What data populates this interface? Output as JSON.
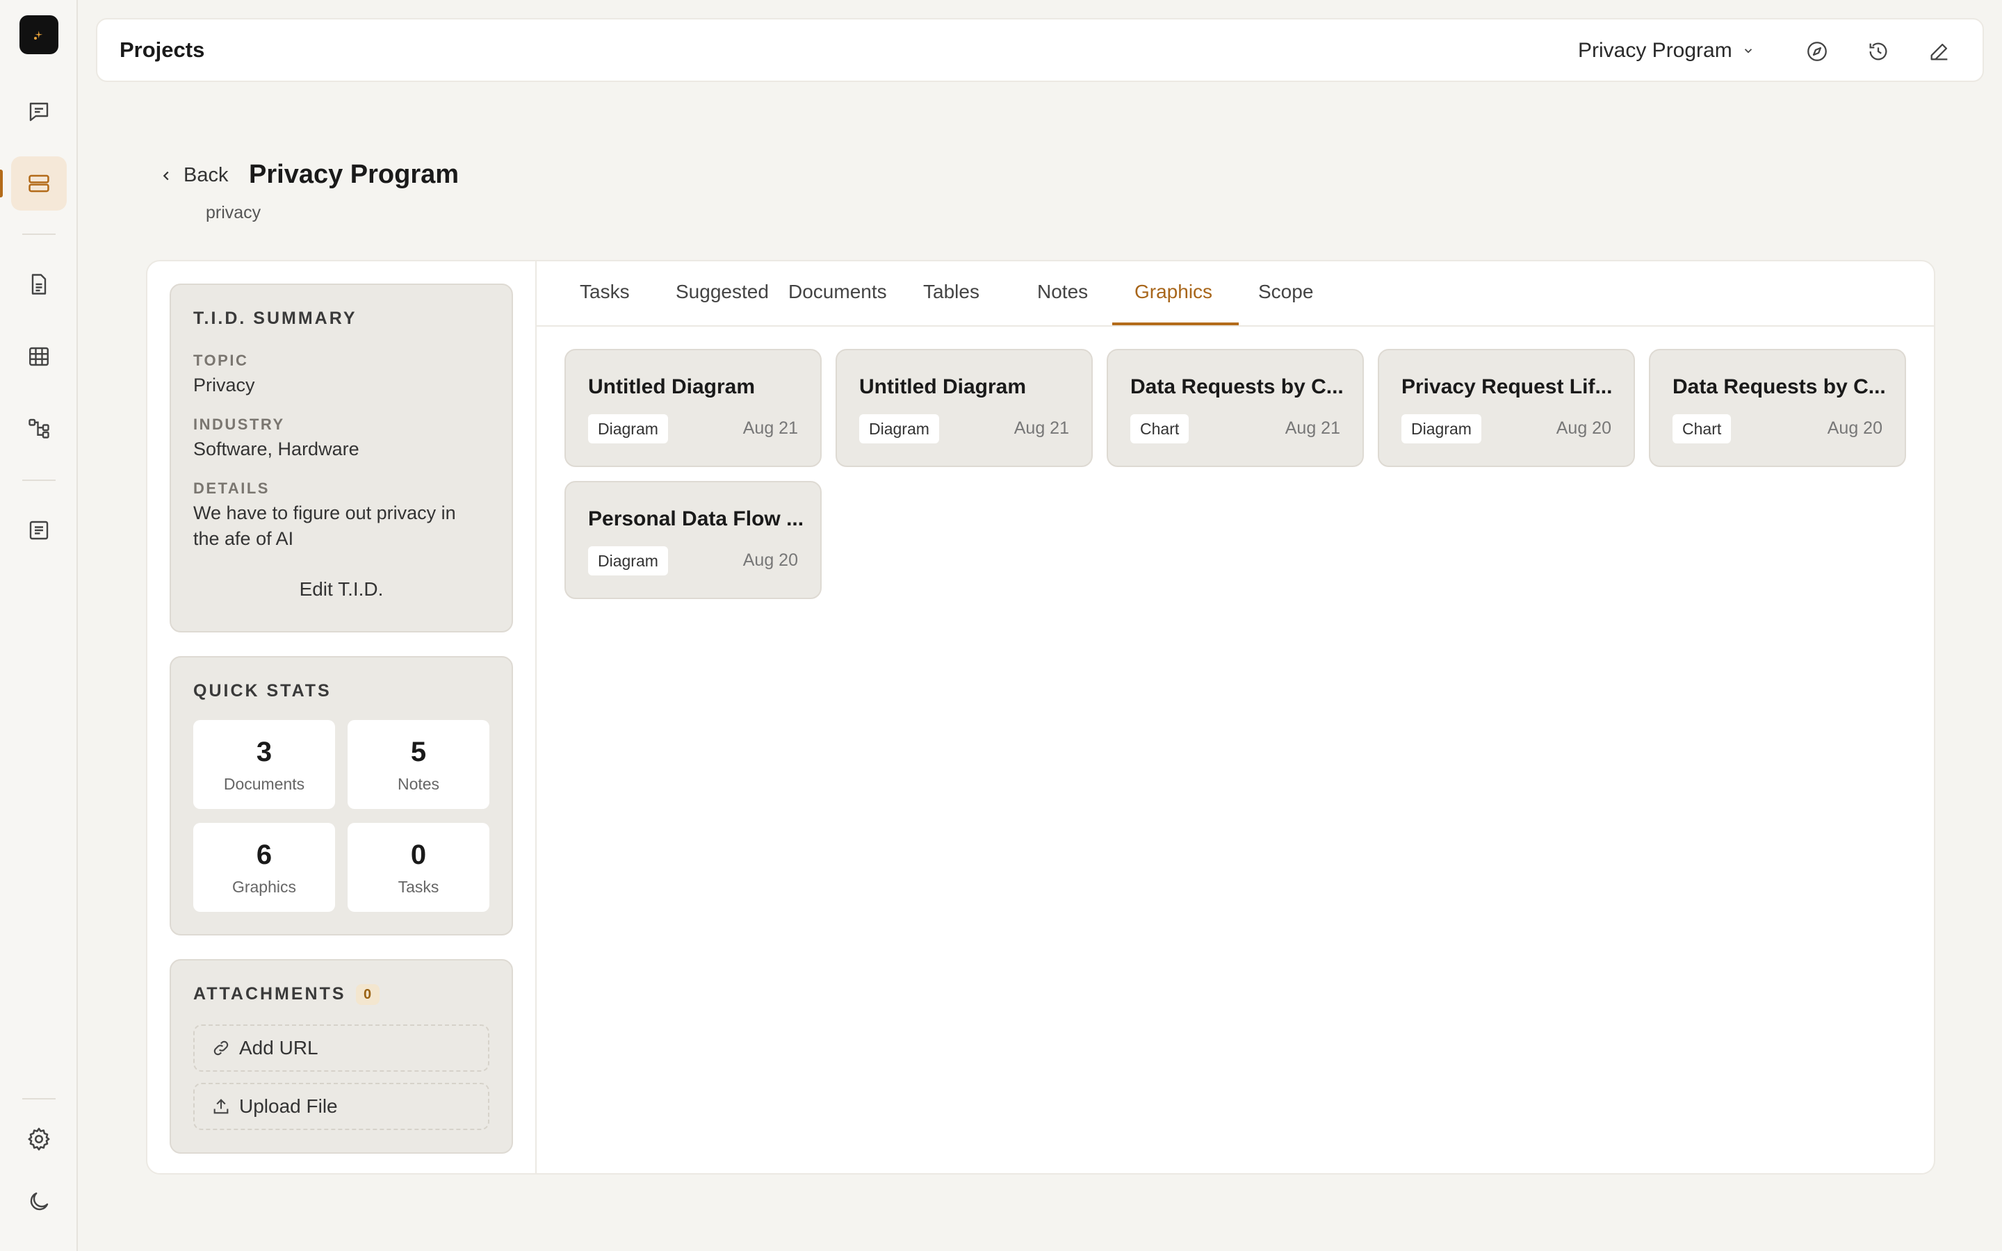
{
  "topbar": {
    "title": "Projects",
    "project_selector": "Privacy Program"
  },
  "header": {
    "back_label": "Back",
    "title": "Privacy Program",
    "subtitle": "privacy"
  },
  "summary": {
    "heading": "T.I.D. SUMMARY",
    "topic_label": "TOPIC",
    "topic": "Privacy",
    "industry_label": "INDUSTRY",
    "industry": "Software, Hardware",
    "details_label": "DETAILS",
    "details": "We have to figure out privacy in the afe of AI",
    "edit_label": "Edit T.I.D."
  },
  "quick_stats": {
    "heading": "QUICK STATS",
    "items": [
      {
        "value": "3",
        "label": "Documents"
      },
      {
        "value": "5",
        "label": "Notes"
      },
      {
        "value": "6",
        "label": "Graphics"
      },
      {
        "value": "0",
        "label": "Tasks"
      }
    ]
  },
  "attachments": {
    "heading": "ATTACHMENTS",
    "count": "0",
    "add_url": "Add URL",
    "upload_file": "Upload File"
  },
  "tabs": [
    "Tasks",
    "Suggested",
    "Documents",
    "Tables",
    "Notes",
    "Graphics",
    "Scope"
  ],
  "active_tab": "Graphics",
  "graphics": [
    {
      "title": "Untitled Diagram",
      "type": "Diagram",
      "date": "Aug 21"
    },
    {
      "title": "Untitled Diagram",
      "type": "Diagram",
      "date": "Aug 21"
    },
    {
      "title": "Data Requests by C...",
      "type": "Chart",
      "date": "Aug 21"
    },
    {
      "title": "Privacy Request Lif...",
      "type": "Diagram",
      "date": "Aug 20"
    },
    {
      "title": "Data Requests by C...",
      "type": "Chart",
      "date": "Aug 20"
    },
    {
      "title": "Personal Data Flow ...",
      "type": "Diagram",
      "date": "Aug 20"
    }
  ],
  "colors": {
    "accent": "#b36b1a",
    "background": "#f5f4f0",
    "card": "#ebe9e4"
  },
  "icons": {
    "rail": [
      "chat-icon",
      "projects-icon",
      "document-icon",
      "table-icon",
      "workflow-icon",
      "notes-icon",
      "settings-icon",
      "moon-icon"
    ],
    "topbar": [
      "compass-icon",
      "history-icon",
      "edit-icon"
    ]
  }
}
